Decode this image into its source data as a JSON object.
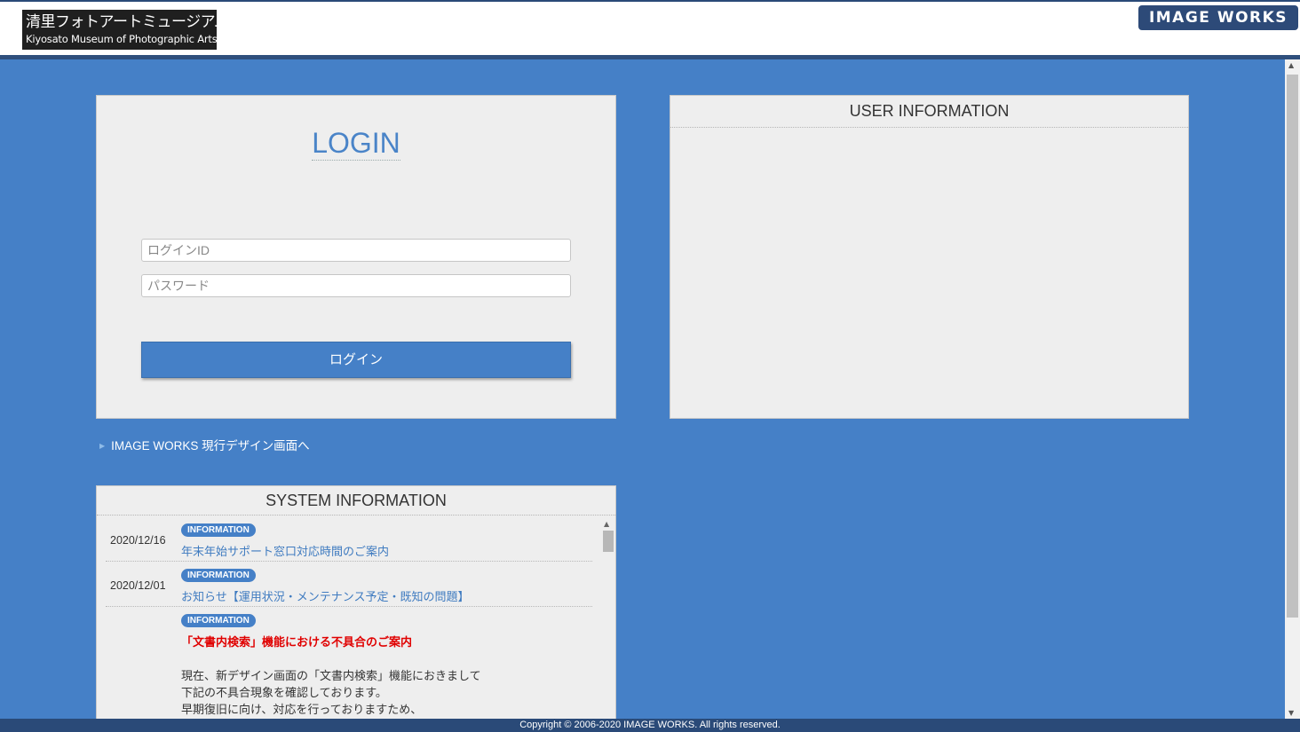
{
  "header": {
    "logo_jp": "清里フォトアートミュージアム",
    "logo_en": "Kiyosato Museum of Photographic Arts",
    "brand": "IMAGE WORKS"
  },
  "login": {
    "title": "LOGIN",
    "id_placeholder": "ログインID",
    "password_placeholder": "パスワード",
    "button_label": "ログイン"
  },
  "user_info": {
    "title": "USER INFORMATION"
  },
  "legacy_link": {
    "label": "IMAGE WORKS 現行デザイン画面へ"
  },
  "system_info": {
    "title": "SYSTEM INFORMATION",
    "items": [
      {
        "date": "2020/12/16",
        "badge": "INFORMATION",
        "title": "年末年始サポート窓口対応時間のご案内"
      },
      {
        "date": "2020/12/01",
        "badge": "INFORMATION",
        "title": "お知らせ【運用状況・メンテナンス予定・既知の問題】"
      },
      {
        "date": "",
        "badge": "INFORMATION",
        "title": "「文書内検索」機能における不具合のご案内",
        "body": [
          "現在、新デザイン画面の「文書内検索」機能におきまして",
          "下記の不具合現象を確認しております。",
          "早期復旧に向け、対応を行っておりますため、"
        ]
      }
    ]
  },
  "footer": {
    "copyright": "Copyright © 2006-2020 IMAGE WORKS. All rights reserved."
  },
  "colors": {
    "background": "#4580c7",
    "header_bar": "#2f4f7d",
    "panel": "#eeeeee",
    "link_blue": "#3f7bc0",
    "alert_red": "#e00000"
  }
}
